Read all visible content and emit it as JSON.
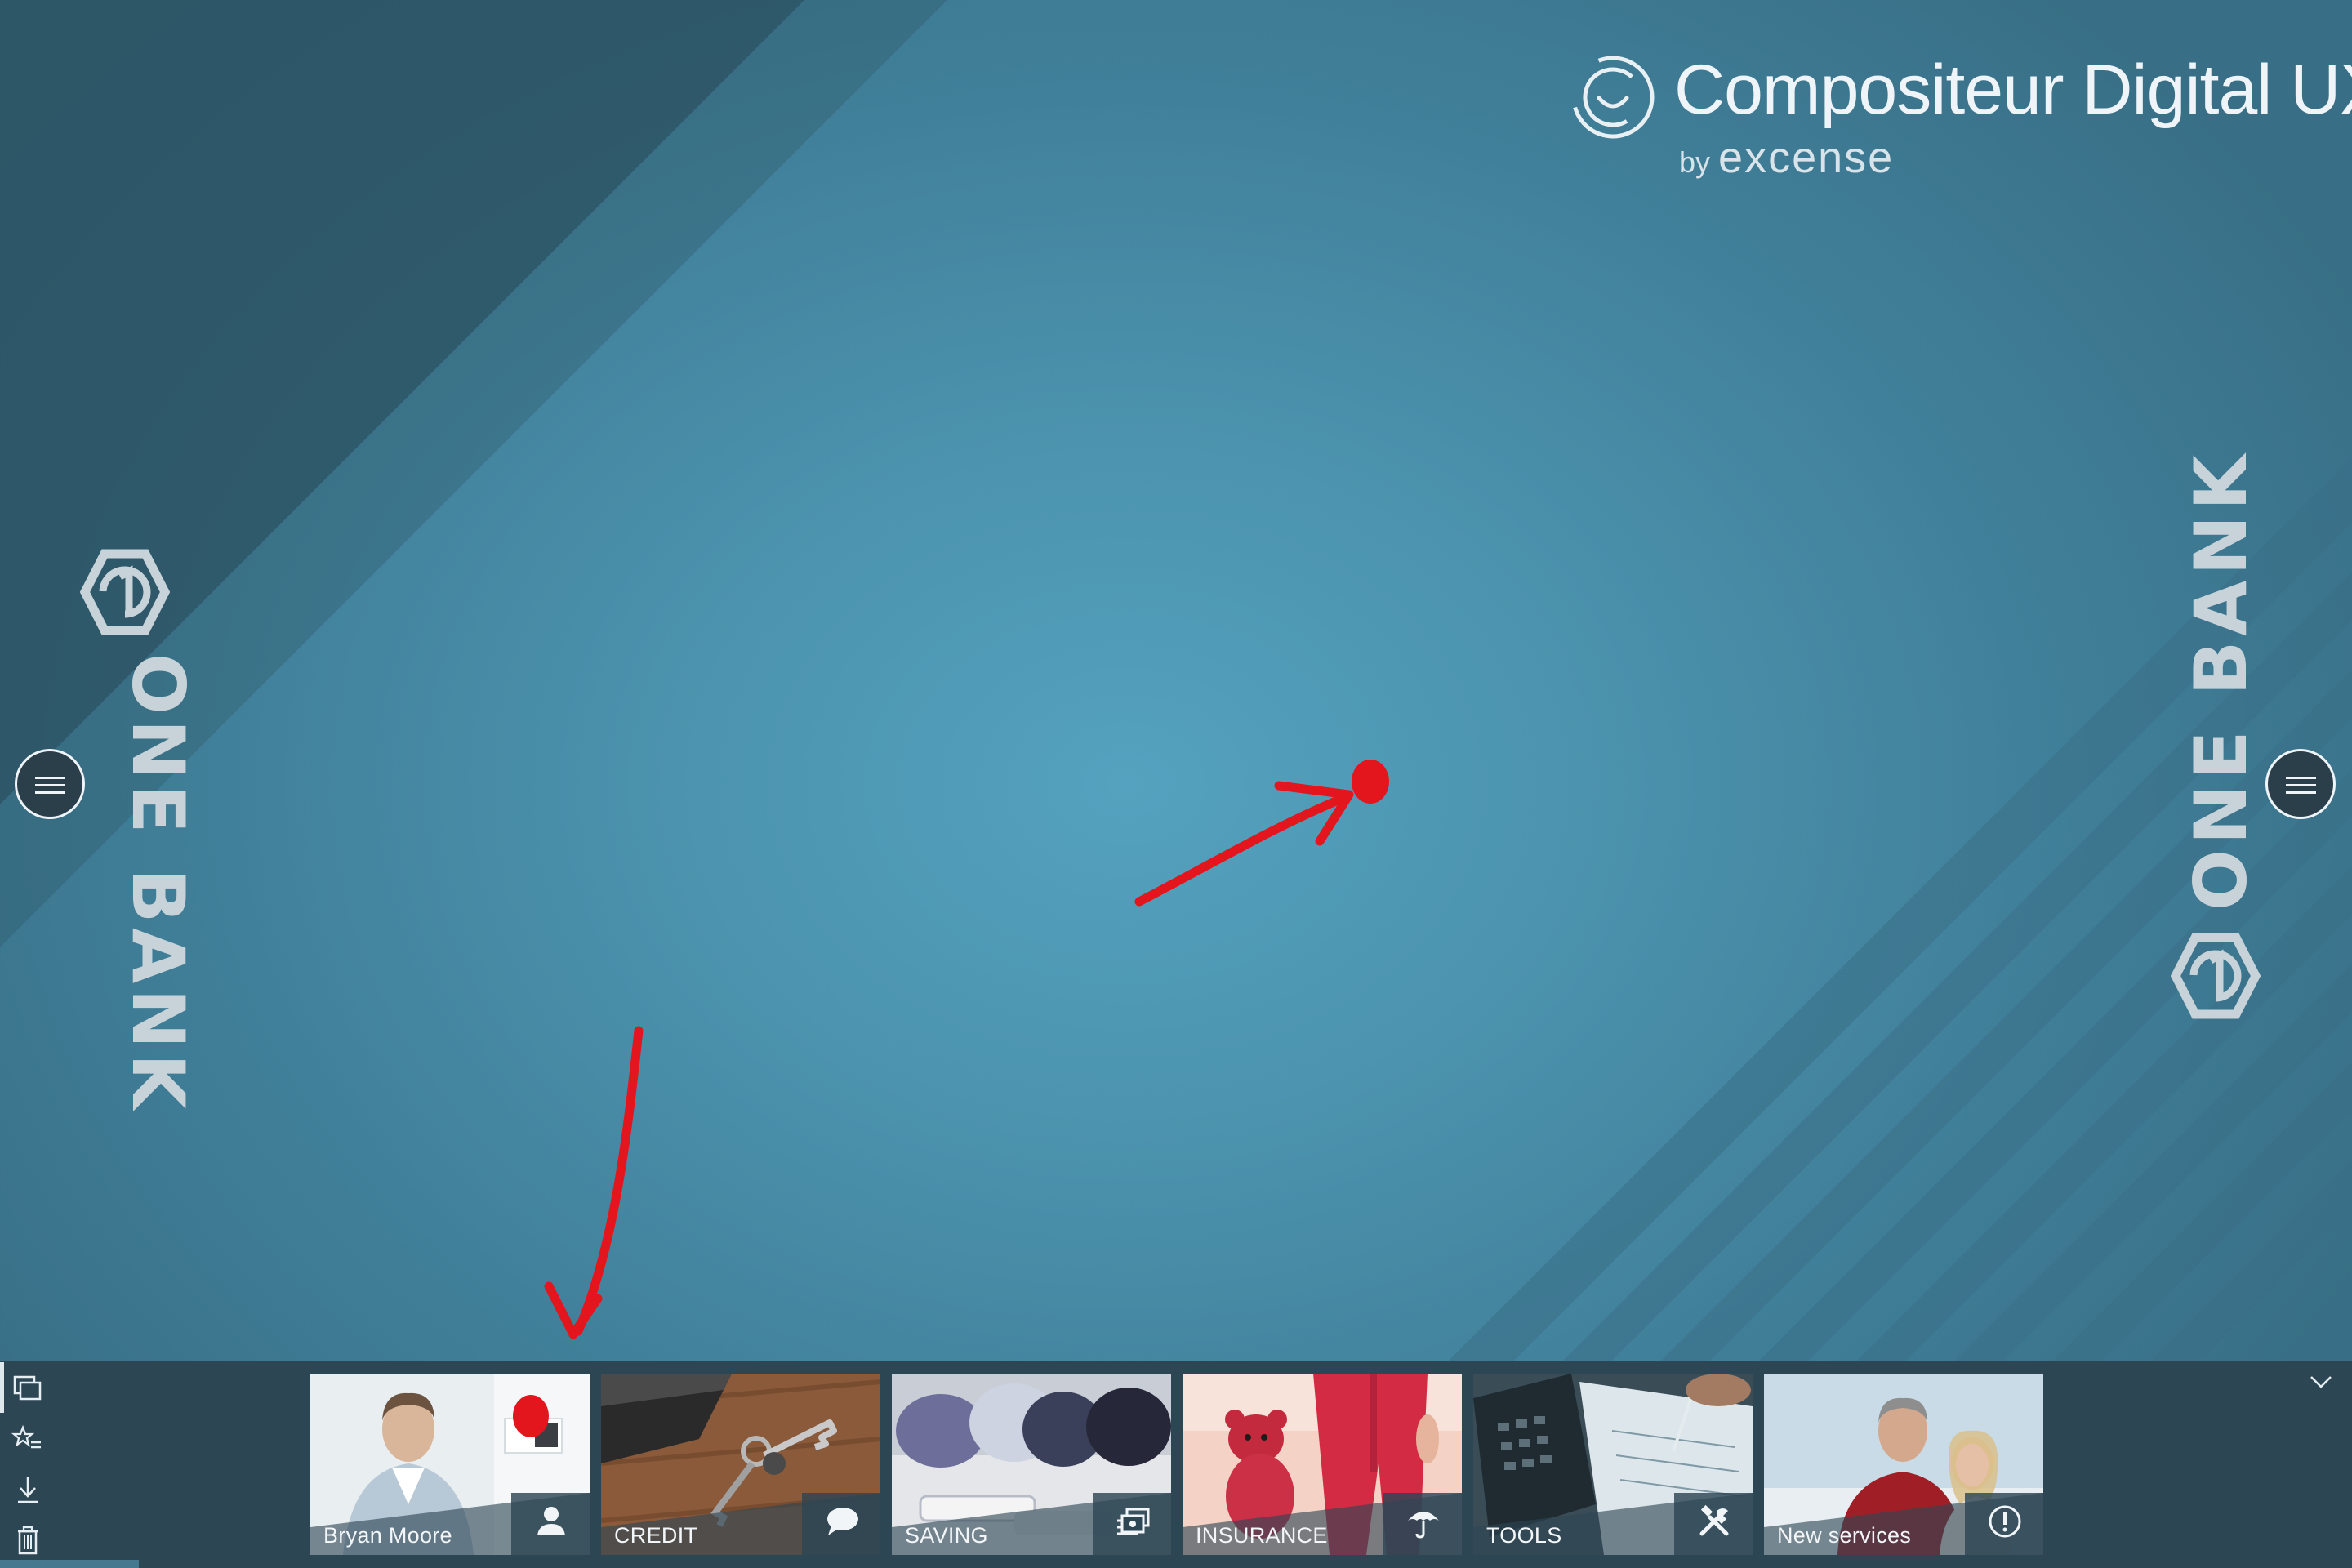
{
  "header": {
    "app_name": "Compositeur Digital UX",
    "by_label": "by",
    "vendor": "excense",
    "logo_icon": "compositeur-logo-icon"
  },
  "branding": {
    "left_text": "ONE BANK",
    "right_text": "ONE BANK",
    "mark_icon": "one-bank-hex-icon"
  },
  "side_menus": {
    "left_icon": "hamburger-menu-icon",
    "right_icon": "hamburger-menu-icon"
  },
  "toolbar": {
    "icons": [
      "windows-icon",
      "star-list-icon",
      "download-icon",
      "trash-icon"
    ]
  },
  "dock": {
    "collapse_icon": "chevron-down-icon",
    "tiles": [
      {
        "label": "Bryan Moore",
        "icon": "person-icon"
      },
      {
        "label": "CREDIT",
        "icon": "speech-bubble-icon"
      },
      {
        "label": "SAVING",
        "icon": "money-stack-icon"
      },
      {
        "label": "INSURANCE",
        "icon": "umbrella-icon"
      },
      {
        "label": "TOOLS",
        "icon": "tools-icon"
      },
      {
        "label": "New services",
        "icon": "alert-circle-icon"
      }
    ]
  },
  "annotations": {
    "marker_color": "#e3161e"
  }
}
